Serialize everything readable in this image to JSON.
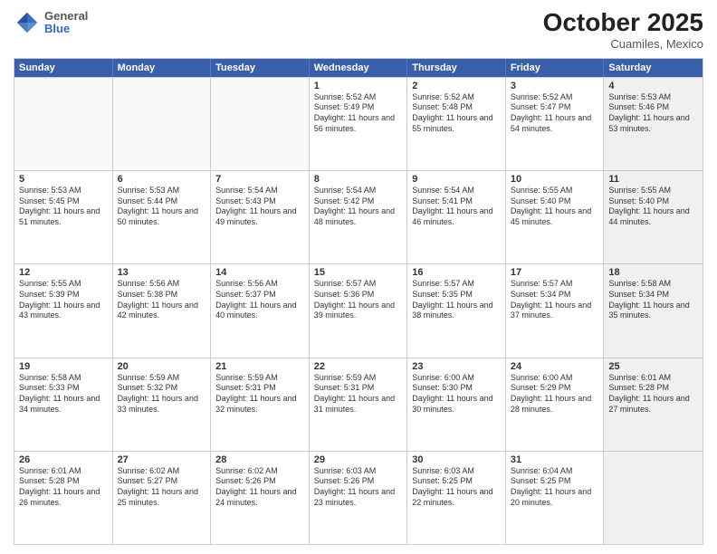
{
  "header": {
    "logo": {
      "general": "General",
      "blue": "Blue"
    },
    "title": "October 2025",
    "location": "Cuamiles, Mexico"
  },
  "days_of_week": [
    "Sunday",
    "Monday",
    "Tuesday",
    "Wednesday",
    "Thursday",
    "Friday",
    "Saturday"
  ],
  "rows": [
    [
      {
        "day": "",
        "empty": true
      },
      {
        "day": "",
        "empty": true
      },
      {
        "day": "",
        "empty": true
      },
      {
        "day": "1",
        "sunrise": "Sunrise: 5:52 AM",
        "sunset": "Sunset: 5:49 PM",
        "daylight": "Daylight: 11 hours and 56 minutes."
      },
      {
        "day": "2",
        "sunrise": "Sunrise: 5:52 AM",
        "sunset": "Sunset: 5:48 PM",
        "daylight": "Daylight: 11 hours and 55 minutes."
      },
      {
        "day": "3",
        "sunrise": "Sunrise: 5:52 AM",
        "sunset": "Sunset: 5:47 PM",
        "daylight": "Daylight: 11 hours and 54 minutes."
      },
      {
        "day": "4",
        "sunrise": "Sunrise: 5:53 AM",
        "sunset": "Sunset: 5:46 PM",
        "daylight": "Daylight: 11 hours and 53 minutes.",
        "shaded": true
      }
    ],
    [
      {
        "day": "5",
        "sunrise": "Sunrise: 5:53 AM",
        "sunset": "Sunset: 5:45 PM",
        "daylight": "Daylight: 11 hours and 51 minutes."
      },
      {
        "day": "6",
        "sunrise": "Sunrise: 5:53 AM",
        "sunset": "Sunset: 5:44 PM",
        "daylight": "Daylight: 11 hours and 50 minutes."
      },
      {
        "day": "7",
        "sunrise": "Sunrise: 5:54 AM",
        "sunset": "Sunset: 5:43 PM",
        "daylight": "Daylight: 11 hours and 49 minutes."
      },
      {
        "day": "8",
        "sunrise": "Sunrise: 5:54 AM",
        "sunset": "Sunset: 5:42 PM",
        "daylight": "Daylight: 11 hours and 48 minutes."
      },
      {
        "day": "9",
        "sunrise": "Sunrise: 5:54 AM",
        "sunset": "Sunset: 5:41 PM",
        "daylight": "Daylight: 11 hours and 46 minutes."
      },
      {
        "day": "10",
        "sunrise": "Sunrise: 5:55 AM",
        "sunset": "Sunset: 5:40 PM",
        "daylight": "Daylight: 11 hours and 45 minutes."
      },
      {
        "day": "11",
        "sunrise": "Sunrise: 5:55 AM",
        "sunset": "Sunset: 5:40 PM",
        "daylight": "Daylight: 11 hours and 44 minutes.",
        "shaded": true
      }
    ],
    [
      {
        "day": "12",
        "sunrise": "Sunrise: 5:55 AM",
        "sunset": "Sunset: 5:39 PM",
        "daylight": "Daylight: 11 hours and 43 minutes."
      },
      {
        "day": "13",
        "sunrise": "Sunrise: 5:56 AM",
        "sunset": "Sunset: 5:38 PM",
        "daylight": "Daylight: 11 hours and 42 minutes."
      },
      {
        "day": "14",
        "sunrise": "Sunrise: 5:56 AM",
        "sunset": "Sunset: 5:37 PM",
        "daylight": "Daylight: 11 hours and 40 minutes."
      },
      {
        "day": "15",
        "sunrise": "Sunrise: 5:57 AM",
        "sunset": "Sunset: 5:36 PM",
        "daylight": "Daylight: 11 hours and 39 minutes."
      },
      {
        "day": "16",
        "sunrise": "Sunrise: 5:57 AM",
        "sunset": "Sunset: 5:35 PM",
        "daylight": "Daylight: 11 hours and 38 minutes."
      },
      {
        "day": "17",
        "sunrise": "Sunrise: 5:57 AM",
        "sunset": "Sunset: 5:34 PM",
        "daylight": "Daylight: 11 hours and 37 minutes."
      },
      {
        "day": "18",
        "sunrise": "Sunrise: 5:58 AM",
        "sunset": "Sunset: 5:34 PM",
        "daylight": "Daylight: 11 hours and 35 minutes.",
        "shaded": true
      }
    ],
    [
      {
        "day": "19",
        "sunrise": "Sunrise: 5:58 AM",
        "sunset": "Sunset: 5:33 PM",
        "daylight": "Daylight: 11 hours and 34 minutes."
      },
      {
        "day": "20",
        "sunrise": "Sunrise: 5:59 AM",
        "sunset": "Sunset: 5:32 PM",
        "daylight": "Daylight: 11 hours and 33 minutes."
      },
      {
        "day": "21",
        "sunrise": "Sunrise: 5:59 AM",
        "sunset": "Sunset: 5:31 PM",
        "daylight": "Daylight: 11 hours and 32 minutes."
      },
      {
        "day": "22",
        "sunrise": "Sunrise: 5:59 AM",
        "sunset": "Sunset: 5:31 PM",
        "daylight": "Daylight: 11 hours and 31 minutes."
      },
      {
        "day": "23",
        "sunrise": "Sunrise: 6:00 AM",
        "sunset": "Sunset: 5:30 PM",
        "daylight": "Daylight: 11 hours and 30 minutes."
      },
      {
        "day": "24",
        "sunrise": "Sunrise: 6:00 AM",
        "sunset": "Sunset: 5:29 PM",
        "daylight": "Daylight: 11 hours and 28 minutes."
      },
      {
        "day": "25",
        "sunrise": "Sunrise: 6:01 AM",
        "sunset": "Sunset: 5:28 PM",
        "daylight": "Daylight: 11 hours and 27 minutes.",
        "shaded": true
      }
    ],
    [
      {
        "day": "26",
        "sunrise": "Sunrise: 6:01 AM",
        "sunset": "Sunset: 5:28 PM",
        "daylight": "Daylight: 11 hours and 26 minutes."
      },
      {
        "day": "27",
        "sunrise": "Sunrise: 6:02 AM",
        "sunset": "Sunset: 5:27 PM",
        "daylight": "Daylight: 11 hours and 25 minutes."
      },
      {
        "day": "28",
        "sunrise": "Sunrise: 6:02 AM",
        "sunset": "Sunset: 5:26 PM",
        "daylight": "Daylight: 11 hours and 24 minutes."
      },
      {
        "day": "29",
        "sunrise": "Sunrise: 6:03 AM",
        "sunset": "Sunset: 5:26 PM",
        "daylight": "Daylight: 11 hours and 23 minutes."
      },
      {
        "day": "30",
        "sunrise": "Sunrise: 6:03 AM",
        "sunset": "Sunset: 5:25 PM",
        "daylight": "Daylight: 11 hours and 22 minutes."
      },
      {
        "day": "31",
        "sunrise": "Sunrise: 6:04 AM",
        "sunset": "Sunset: 5:25 PM",
        "daylight": "Daylight: 11 hours and 20 minutes."
      },
      {
        "day": "",
        "empty": true,
        "shaded": true
      }
    ]
  ]
}
